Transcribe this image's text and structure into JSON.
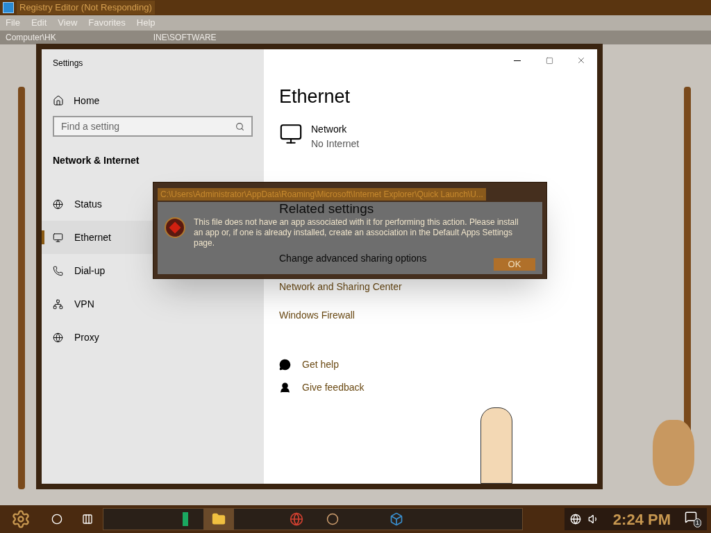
{
  "registry_window": {
    "title": "Registry Editor (Not Responding)",
    "menu": [
      "File",
      "Edit",
      "View",
      "Favorites",
      "Help"
    ],
    "address": [
      "Computer\\HK",
      "INE\\SOFTWARE"
    ]
  },
  "settings_window": {
    "title": "Settings",
    "home": "Home",
    "search": {
      "placeholder": "Find a setting"
    },
    "section": "Network & Internet",
    "nav": [
      {
        "label": "Status",
        "selected": false
      },
      {
        "label": "Ethernet",
        "selected": true
      },
      {
        "label": "Dial-up",
        "selected": false
      },
      {
        "label": "VPN",
        "selected": false
      },
      {
        "label": "Proxy",
        "selected": false
      }
    ],
    "page_title": "Ethernet",
    "network": {
      "name": "Network",
      "status": "No Internet"
    },
    "related_heading": "Related settings",
    "links": [
      "Change advanced sharing options",
      "Network and Sharing Center",
      "Windows Firewall"
    ],
    "help": [
      {
        "kind": "help",
        "label": "Get help"
      },
      {
        "kind": "feedback",
        "label": "Give feedback"
      }
    ]
  },
  "error_dialog": {
    "title": "C:\\Users\\Administrator\\AppData\\Roaming\\Microsoft\\Internet Explorer\\Quick Launch\\U...",
    "message": "This file does not have an app associated with it for performing this action. Please install an app or, if one is already installed, create an association in the Default Apps Settings page.",
    "button": "OK"
  },
  "taskbar": {
    "clock": "2:24 PM",
    "notification_count": "1"
  }
}
